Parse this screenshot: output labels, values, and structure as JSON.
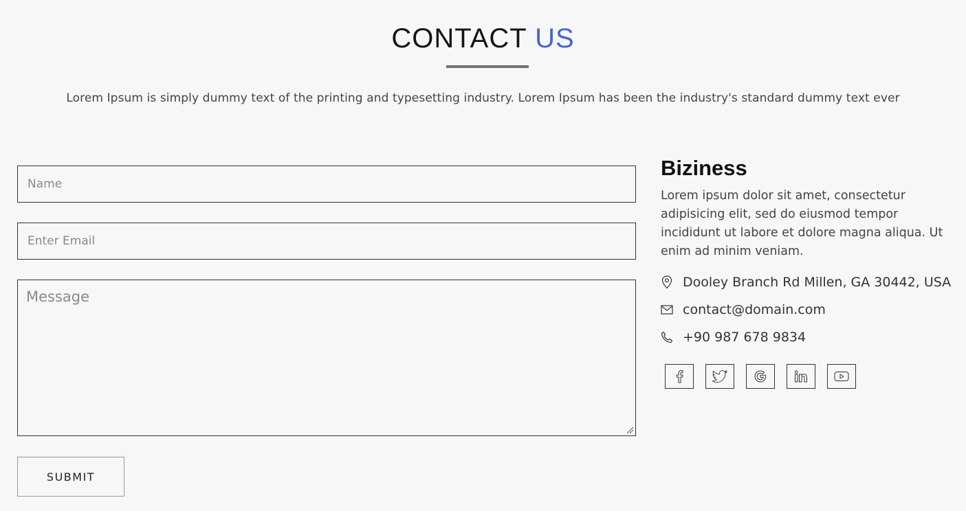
{
  "header": {
    "title_main": "CONTACT",
    "title_accent": "US",
    "lead": "Lorem Ipsum is simply dummy text of the printing and typesetting industry. Lorem Ipsum has been the industry's standard dummy text ever"
  },
  "form": {
    "name_placeholder": "Name",
    "name_value": "",
    "email_placeholder": "Enter Email",
    "email_value": "",
    "message_placeholder": "Message",
    "message_value": "",
    "submit_label": "SUBMIT"
  },
  "info": {
    "business_name": "Biziness",
    "description": "Lorem ipsum dolor sit amet, consectetur adipisicing elit, sed do eiusmod tempor incididunt ut labore et dolore magna aliqua. Ut enim ad minim veniam.",
    "address": "Dooley Branch Rd Millen, GA 30442, USA",
    "email": "contact@domain.com",
    "phone": "+90 987 678 9834"
  },
  "socials": [
    {
      "icon": "facebook-icon"
    },
    {
      "icon": "twitter-icon"
    },
    {
      "icon": "google-icon"
    },
    {
      "icon": "linkedin-icon"
    },
    {
      "icon": "youtube-icon"
    }
  ],
  "colors": {
    "accent": "#4466cc",
    "background": "#f7f7f7",
    "rule": "#757070"
  }
}
